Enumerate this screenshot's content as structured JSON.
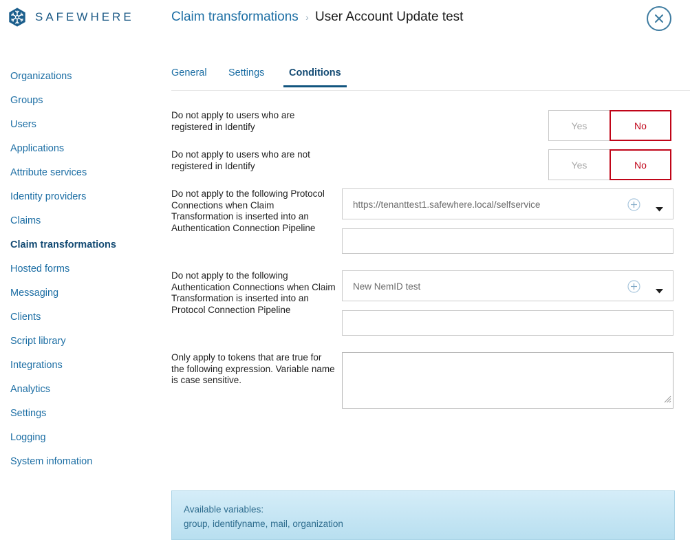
{
  "header": {
    "brand_name": "SAFEWHERE",
    "logo_icon": "snowflake-hexagon-logo",
    "breadcrumb": {
      "parent": "Claim transformations",
      "separator": "›",
      "current": "User Account Update test"
    },
    "close_icon": "close-icon",
    "accent_blue": "#1c6ea4",
    "brand_blue": "#1c5a86"
  },
  "sidebar": {
    "items": [
      {
        "label": "Organizations",
        "active": false
      },
      {
        "label": "Groups",
        "active": false
      },
      {
        "label": "Users",
        "active": false
      },
      {
        "label": "Applications",
        "active": false
      },
      {
        "label": "Attribute services",
        "active": false
      },
      {
        "label": "Identity providers",
        "active": false
      },
      {
        "label": "Claims",
        "active": false
      },
      {
        "label": "Claim transformations",
        "active": true
      },
      {
        "label": "Hosted forms",
        "active": false
      },
      {
        "label": "Messaging",
        "active": false
      },
      {
        "label": "Clients",
        "active": false
      },
      {
        "label": "Script library",
        "active": false
      },
      {
        "label": "Integrations",
        "active": false
      },
      {
        "label": "Analytics",
        "active": false
      },
      {
        "label": "Settings",
        "active": false
      },
      {
        "label": "Logging",
        "active": false
      },
      {
        "label": "System infomation",
        "active": false
      }
    ]
  },
  "main": {
    "tabs": [
      {
        "label": "General",
        "active": false
      },
      {
        "label": "Settings",
        "active": false
      },
      {
        "label": "Conditions",
        "active": true
      }
    ],
    "rows": {
      "registered": {
        "label": "Do not apply to users who are registered in Identify",
        "options": [
          {
            "label": "Yes",
            "selected": false
          },
          {
            "label": "No",
            "selected": true
          }
        ]
      },
      "not_registered": {
        "label": "Do not apply to users who are not registered in Identify",
        "options": [
          {
            "label": "Yes",
            "selected": false
          },
          {
            "label": "No",
            "selected": true
          }
        ]
      },
      "protocol_connections": {
        "label": "Do not apply to the following Protocol Connections when Claim Transformation is inserted into an Authentication Connection Pipeline",
        "selected_value": "https://tenanttest1.safewhere.local/selfservice",
        "secondary_value": "",
        "add_icon": "plus-circle-icon",
        "dropdown_icon": "caret-down-icon"
      },
      "authentication_connections": {
        "label": "Do not apply to the following Authentication Connections when Claim Transformation is inserted into an Protocol Connection Pipeline",
        "selected_value": "New NemID test",
        "secondary_value": "",
        "add_icon": "plus-circle-icon",
        "dropdown_icon": "caret-down-icon"
      },
      "expression": {
        "label": "Only apply to tokens that are true for the following expression. Variable name is case sensitive.",
        "value": "",
        "resize_icon": "resize-grip-icon"
      }
    },
    "info_panel": {
      "title": "Available variables:",
      "variables": "group, identifyname, mail, organization"
    },
    "selected_color": "#c00418",
    "unselected_color": "#a8a8a8"
  }
}
